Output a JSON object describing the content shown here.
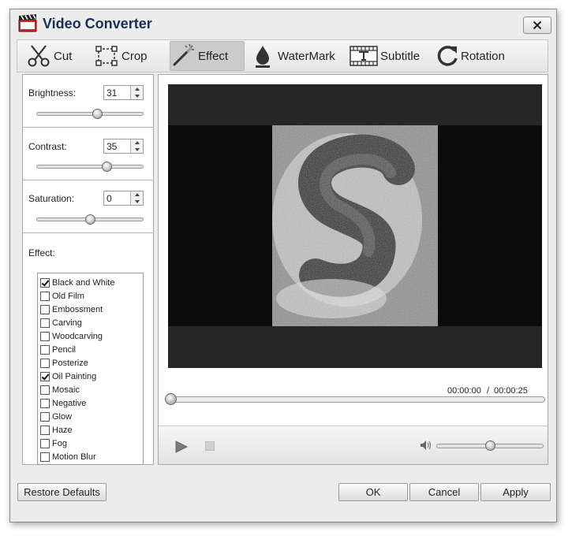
{
  "window": {
    "title": "Video Converter"
  },
  "toolbar": {
    "tabs": [
      {
        "label": "Cut",
        "icon": "scissors-icon",
        "active": false
      },
      {
        "label": "Crop",
        "icon": "crop-icon",
        "active": false
      },
      {
        "label": "Effect",
        "icon": "magic-wand-icon",
        "active": true
      },
      {
        "label": "WaterMark",
        "icon": "water-drop-icon",
        "active": false
      },
      {
        "label": "Subtitle",
        "icon": "subtitle-film-icon",
        "active": false
      },
      {
        "label": "Rotation",
        "icon": "rotate-icon",
        "active": false
      }
    ]
  },
  "adjustments": {
    "brightness": {
      "label": "Brightness:",
      "value": "31",
      "slider_fraction": 0.57
    },
    "contrast": {
      "label": "Contrast:",
      "value": "35",
      "slider_fraction": 0.66
    },
    "saturation": {
      "label": "Saturation:",
      "value": "0",
      "slider_fraction": 0.5
    }
  },
  "effects": {
    "label": "Effect:",
    "items": [
      {
        "label": "Black and White",
        "checked": true
      },
      {
        "label": "Old Film",
        "checked": false
      },
      {
        "label": "Embossment",
        "checked": false
      },
      {
        "label": "Carving",
        "checked": false
      },
      {
        "label": "Woodcarving",
        "checked": false
      },
      {
        "label": "Pencil",
        "checked": false
      },
      {
        "label": "Posterize",
        "checked": false
      },
      {
        "label": "Oil Painting",
        "checked": true
      },
      {
        "label": "Mosaic",
        "checked": false
      },
      {
        "label": "Negative",
        "checked": false
      },
      {
        "label": "Glow",
        "checked": false
      },
      {
        "label": "Haze",
        "checked": false
      },
      {
        "label": "Fog",
        "checked": false
      },
      {
        "label": "Motion Blur",
        "checked": false
      }
    ]
  },
  "player": {
    "current_time": "00:00:00",
    "separator": "/",
    "duration": "00:00:25",
    "seek_fraction": 0.0,
    "volume_fraction": 0.5
  },
  "buttons": {
    "restore": "Restore Defaults",
    "ok": "OK",
    "cancel": "Cancel",
    "apply": "Apply"
  }
}
